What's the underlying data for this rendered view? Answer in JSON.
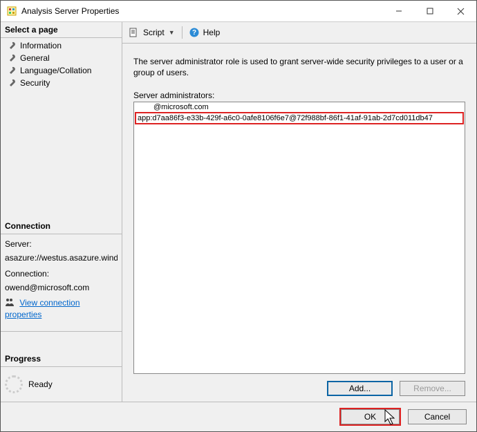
{
  "window": {
    "title": "Analysis Server Properties"
  },
  "sidebar": {
    "select_page_header": "Select a page",
    "pages": [
      {
        "label": "Information"
      },
      {
        "label": "General"
      },
      {
        "label": "Language/Collation"
      },
      {
        "label": "Security"
      }
    ],
    "connection_header": "Connection",
    "server_label": "Server:",
    "server_value": "asazure://westus.asazure.windows",
    "connection_label": "Connection:",
    "connection_value": "owend@microsoft.com",
    "view_connection_properties": "View connection properties",
    "progress_header": "Progress",
    "progress_status": "Ready"
  },
  "toolbar": {
    "script_label": "Script",
    "help_label": "Help"
  },
  "main": {
    "description": "The server administrator role is used to grant server-wide security privileges to a user or a group of users.",
    "admins_label": "Server administrators:",
    "admins": [
      "@microsoft.com",
      "app:d7aa86f3-e33b-429f-a6c0-0afe8106f6e7@72f988bf-86f1-41af-91ab-2d7cd011db47"
    ],
    "add_label": "Add...",
    "remove_label": "Remove..."
  },
  "footer": {
    "ok_label": "OK",
    "cancel_label": "Cancel"
  }
}
